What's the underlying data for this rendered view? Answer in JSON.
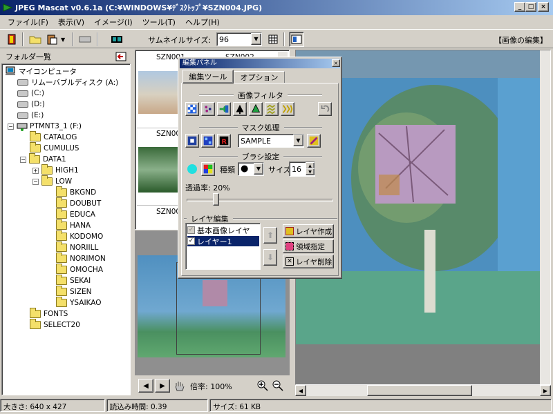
{
  "window": {
    "title": "JPEG Mascat v0.6.1a (C:¥WINDOWS¥ﾃﾞｽｸﾄｯﾌﾟ¥SZN004.JPG)"
  },
  "menu": [
    "ファイル(F)",
    "表示(V)",
    "イメージ(I)",
    "ツール(T)",
    "ヘルプ(H)"
  ],
  "toolbar": {
    "thumb_size_label": "サムネイルサイズ:",
    "thumb_size_value": "96",
    "mode_label": "【画像の編集】"
  },
  "folders": {
    "header": "フォルダ一覧",
    "tree": [
      {
        "label": "マイコンピュータ",
        "type": "computer"
      },
      {
        "label": "リムーバブルディスク (A:)",
        "type": "drive"
      },
      {
        "label": "(C:)",
        "type": "drive"
      },
      {
        "label": "(D:)",
        "type": "drive"
      },
      {
        "label": "(E:)",
        "type": "drive"
      },
      {
        "label": "PTMNT3_1 (F:)",
        "type": "netdrive"
      },
      {
        "label": "CATALOG",
        "type": "folder"
      },
      {
        "label": "CUMULUS",
        "type": "folder"
      },
      {
        "label": "DATA1",
        "type": "folder"
      },
      {
        "label": "HIGH1",
        "type": "folder"
      },
      {
        "label": "LOW",
        "type": "folder"
      },
      {
        "label": "BKGND",
        "type": "folder"
      },
      {
        "label": "DOUBUT",
        "type": "folder"
      },
      {
        "label": "EDUCA",
        "type": "folder"
      },
      {
        "label": "HANA",
        "type": "folder"
      },
      {
        "label": "KODOMO",
        "type": "folder"
      },
      {
        "label": "NORIILL",
        "type": "folder"
      },
      {
        "label": "NORIMON",
        "type": "folder"
      },
      {
        "label": "OMOCHA",
        "type": "folder"
      },
      {
        "label": "SEKAI",
        "type": "folder"
      },
      {
        "label": "SIZEN",
        "type": "folder"
      },
      {
        "label": "YSAIKAO",
        "type": "folder"
      },
      {
        "label": "FONTS",
        "type": "folder"
      },
      {
        "label": "SELECT20",
        "type": "folder"
      }
    ]
  },
  "thumbnails": [
    "SZN001",
    "SZN002",
    "SZN00",
    "SZN00"
  ],
  "nav": {
    "zoom_label": "倍率: 100%"
  },
  "edit_panel": {
    "title": "編集パネル",
    "tabs": [
      "編集ツール",
      "オプション"
    ],
    "filter_title": "画像フィルタ",
    "mask_title": "マスク処理",
    "mask_value": "SAMPLE",
    "brush_title": "ブラシ設定",
    "brush_kind_label": "種類",
    "brush_size_label": "サイズ",
    "brush_size_value": "16",
    "opacity_label": "透過率: 20%",
    "opacity_value": 0.2,
    "layer_title": "レイヤ編集",
    "layers": [
      {
        "name": "基本画像レイヤ",
        "checked": true,
        "selected": false
      },
      {
        "name": "レイヤー1",
        "checked": true,
        "selected": true
      }
    ],
    "layer_create": "レイヤ作成",
    "area_select": "領域指定",
    "layer_delete": "レイヤ削除"
  },
  "status": {
    "size": "大きさ: 640 x 427",
    "load_time": "読込み時間: 0.39",
    "file_size": "サイズ: 61 KB"
  }
}
